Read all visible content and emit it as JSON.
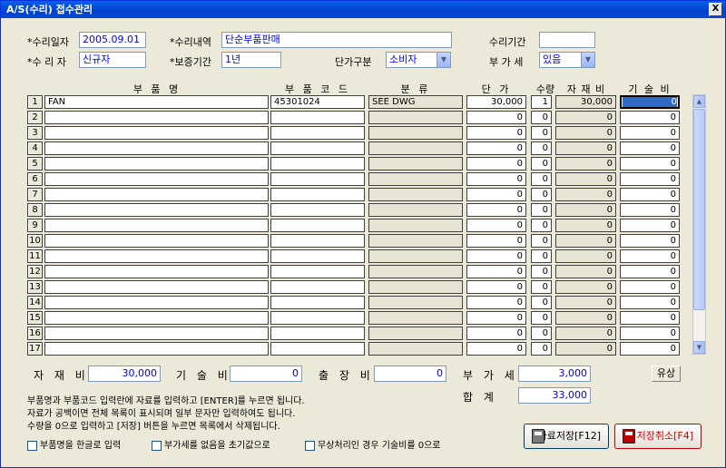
{
  "window": {
    "title": "A/S(수리) 접수관리",
    "close_label": "X"
  },
  "header": {
    "repair_date_label": "*수리일자",
    "repair_date": "2005.09.01",
    "repair_desc_label": "*수리내역",
    "repair_desc": "단순부품판매",
    "repair_period_label": "수리기간",
    "repair_period": "",
    "repairer_label": "*수 리 자",
    "repairer": "신규자",
    "warranty_label": "*보증기간",
    "warranty": "1년",
    "price_type_label": "단가구분",
    "price_type": "소비자",
    "vat_label": "부 가 세",
    "vat_option": "있음"
  },
  "grid": {
    "columns": [
      "부 품 명",
      "부 품 코 드",
      "분  류",
      "단 가",
      "수량",
      "자 재 비",
      "기 술 비"
    ],
    "rows": [
      {
        "no": "1",
        "name": "FAN",
        "code": "45301024",
        "cat": "SEE DWG",
        "price": "30,000",
        "qty": "1",
        "mat": "30,000",
        "tech": "0"
      },
      {
        "no": "2",
        "name": "",
        "code": "",
        "cat": "",
        "price": "0",
        "qty": "0",
        "mat": "0",
        "tech": "0"
      },
      {
        "no": "3",
        "name": "",
        "code": "",
        "cat": "",
        "price": "0",
        "qty": "0",
        "mat": "0",
        "tech": "0"
      },
      {
        "no": "4",
        "name": "",
        "code": "",
        "cat": "",
        "price": "0",
        "qty": "0",
        "mat": "0",
        "tech": "0"
      },
      {
        "no": "5",
        "name": "",
        "code": "",
        "cat": "",
        "price": "0",
        "qty": "0",
        "mat": "0",
        "tech": "0"
      },
      {
        "no": "6",
        "name": "",
        "code": "",
        "cat": "",
        "price": "0",
        "qty": "0",
        "mat": "0",
        "tech": "0"
      },
      {
        "no": "7",
        "name": "",
        "code": "",
        "cat": "",
        "price": "0",
        "qty": "0",
        "mat": "0",
        "tech": "0"
      },
      {
        "no": "8",
        "name": "",
        "code": "",
        "cat": "",
        "price": "0",
        "qty": "0",
        "mat": "0",
        "tech": "0"
      },
      {
        "no": "9",
        "name": "",
        "code": "",
        "cat": "",
        "price": "0",
        "qty": "0",
        "mat": "0",
        "tech": "0"
      },
      {
        "no": "10",
        "name": "",
        "code": "",
        "cat": "",
        "price": "0",
        "qty": "0",
        "mat": "0",
        "tech": "0"
      },
      {
        "no": "11",
        "name": "",
        "code": "",
        "cat": "",
        "price": "0",
        "qty": "0",
        "mat": "0",
        "tech": "0"
      },
      {
        "no": "12",
        "name": "",
        "code": "",
        "cat": "",
        "price": "0",
        "qty": "0",
        "mat": "0",
        "tech": "0"
      },
      {
        "no": "13",
        "name": "",
        "code": "",
        "cat": "",
        "price": "0",
        "qty": "0",
        "mat": "0",
        "tech": "0"
      },
      {
        "no": "14",
        "name": "",
        "code": "",
        "cat": "",
        "price": "0",
        "qty": "0",
        "mat": "0",
        "tech": "0"
      },
      {
        "no": "15",
        "name": "",
        "code": "",
        "cat": "",
        "price": "0",
        "qty": "0",
        "mat": "0",
        "tech": "0"
      },
      {
        "no": "16",
        "name": "",
        "code": "",
        "cat": "",
        "price": "0",
        "qty": "0",
        "mat": "0",
        "tech": "0"
      },
      {
        "no": "17",
        "name": "",
        "code": "",
        "cat": "",
        "price": "0",
        "qty": "0",
        "mat": "0",
        "tech": "0"
      }
    ]
  },
  "totals": {
    "material_label": "자 재 비",
    "material": "30,000",
    "tech_label": "기 술 비",
    "tech": "0",
    "travel_label": "출 장 비",
    "travel": "0",
    "vat_label": "부 가 세",
    "vat": "3,000",
    "sum_label": "합  계",
    "sum": "33,000",
    "paid_label": "유상"
  },
  "notes": [
    "부품명과 부품코드 입력란에 자료를 입력하고 [ENTER]를 누르면 됩니다.",
    "자료가 공백이면 전체 목록이 표시되며 일부 문자만 입력하여도 됩니다.",
    "수량을 0으로 입력하고 [저장] 버튼을 누르면 목록에서 삭제됩니다."
  ],
  "options": {
    "korean_input": "부품명을 한글로 입력",
    "vat_none_default": "부가세를 없음을 초기값으로",
    "free_tech_zero": "무상처리인 경우 기술비를 0으로"
  },
  "buttons": {
    "save": "자료저장[F12]",
    "cancel": "저장취소[F4]"
  }
}
